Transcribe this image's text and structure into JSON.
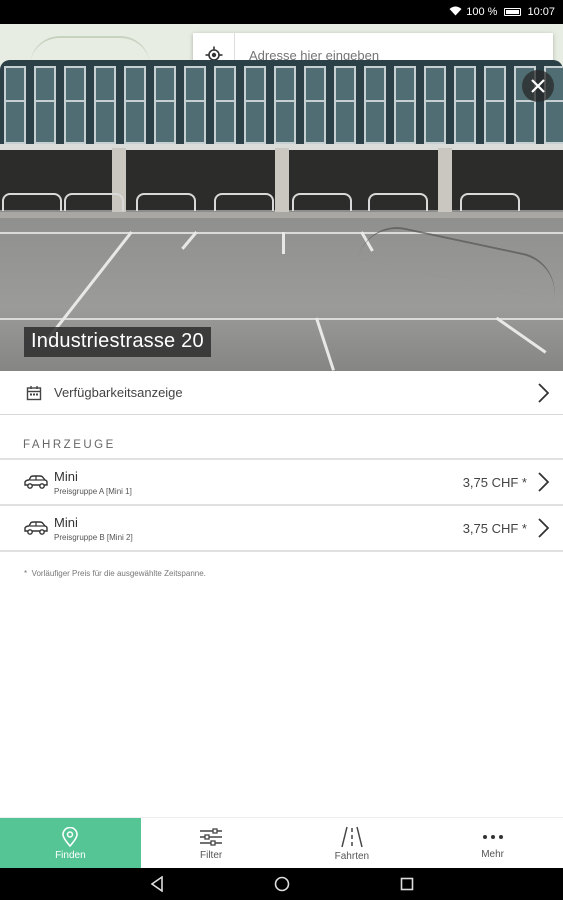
{
  "status": {
    "battery": "100 %",
    "time": "10:07"
  },
  "search": {
    "placeholder": "Adresse hier eingeben"
  },
  "location": {
    "title": "Industriestrasse 20"
  },
  "availability": {
    "label": "Verfügbarkeitsanzeige",
    "icon": "calendar-icon"
  },
  "vehicles": {
    "section_title": "FAHRZEUGE",
    "items": [
      {
        "name": "Mini",
        "group": "Preisgruppe A [Mini 1]",
        "price": "3,75 CHF *",
        "icon": "car-icon"
      },
      {
        "name": "Mini",
        "group": "Preisgruppe B [Mini 2]",
        "price": "3,75 CHF *",
        "icon": "car-icon"
      }
    ]
  },
  "footnote": {
    "mark": "*",
    "text": "Vorläufiger Preis für die ausgewählte Zeitspanne."
  },
  "tabs": [
    {
      "label": "Finden",
      "icon": "location-pin-icon",
      "active": true
    },
    {
      "label": "Filter",
      "icon": "sliders-icon",
      "active": false
    },
    {
      "label": "Fahrten",
      "icon": "road-icon",
      "active": false
    },
    {
      "label": "Mehr",
      "icon": "more-dots-icon",
      "active": false
    }
  ],
  "colors": {
    "accent": "#56c596",
    "statusbar": "#000000"
  }
}
